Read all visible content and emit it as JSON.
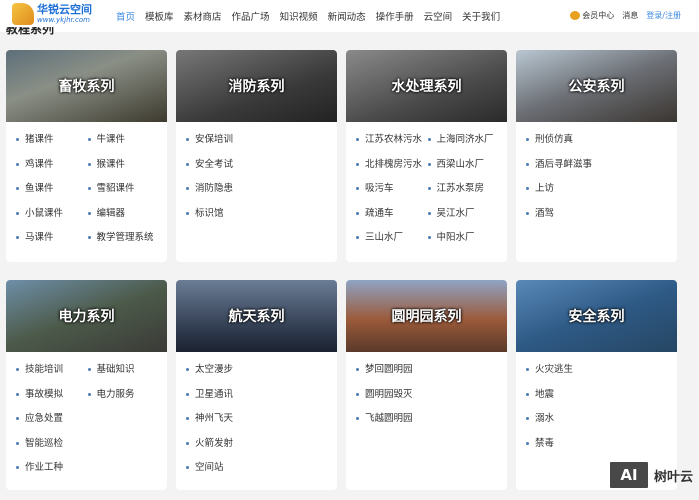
{
  "nav": {
    "logo_title": "华锐云空间",
    "logo_url": "www.ykjhr.com",
    "menu": [
      "首页",
      "模板库",
      "素材商店",
      "作品广场",
      "知识视频",
      "新闻动态",
      "操作手册",
      "云空间",
      "关于我们"
    ],
    "vip": "会员中心",
    "messages": "消息",
    "login": "登录/注册"
  },
  "heading": "教程系列",
  "cards": [
    {
      "title": "畜牧系列",
      "items": [
        "猪课件",
        "牛课件",
        "鸡课件",
        "猴课件",
        "鱼课件",
        "雪貂课件",
        "小鼠课件",
        "编辑器",
        "马课件",
        "教学管理系统"
      ]
    },
    {
      "title": "消防系列",
      "items": [
        "安保培训",
        "安全考试",
        "消防隐患",
        "标识馆"
      ]
    },
    {
      "title": "水处理系列",
      "items": [
        "江苏农林污水",
        "上海同济水厂",
        "北排槐房污水",
        "西梁山水厂",
        "吸污车",
        "江苏水泵房",
        "疏通车",
        "吴江水厂",
        "三山水厂",
        "中阳水厂"
      ]
    },
    {
      "title": "公安系列",
      "items": [
        "刑侦仿真",
        "酒后寻衅滋事",
        "上访",
        "酒驾"
      ]
    },
    {
      "title": "电力系列",
      "items": [
        "技能培训",
        "基础知识",
        "事故模拟",
        "电力服务",
        "应急处置",
        "",
        "智能巡检",
        "",
        "作业工种",
        ""
      ]
    },
    {
      "title": "航天系列",
      "items": [
        "太空漫步",
        "卫星通讯",
        "神州飞天",
        "火箭发射",
        "空间站"
      ]
    },
    {
      "title": "圆明园系列",
      "items": [
        "梦回圆明园",
        "圆明园毁灭",
        "飞越圆明园"
      ]
    },
    {
      "title": "安全系列",
      "items": [
        "火灾逃生",
        "地震",
        "溺水",
        "禁毒"
      ]
    }
  ],
  "watermark": {
    "logo": "AI",
    "text": "树叶云"
  }
}
